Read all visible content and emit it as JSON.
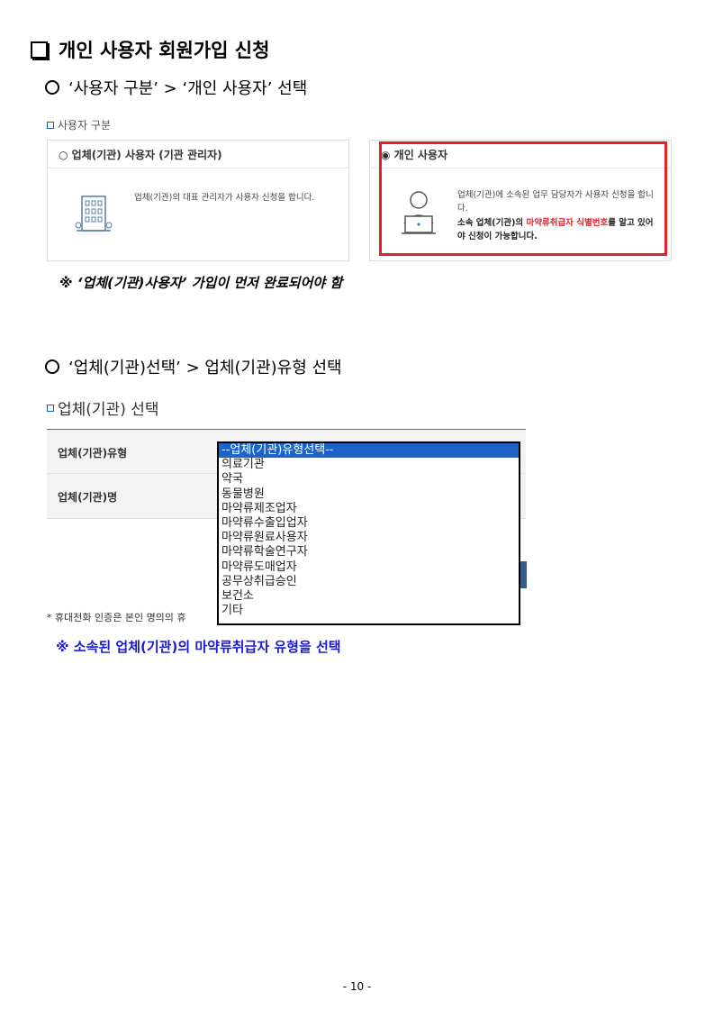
{
  "heading": "개인 사용자 회원가입 신청",
  "step1": {
    "title": "‘사용자 구분’ > ‘개인 사용자’ 선택",
    "section_label": "사용자 구분",
    "card_institution": {
      "title": "○ 업체(기관) 사용자 (기관 관리자)",
      "desc": "업체(기관)의 대표 관리자가 사용자 신청을 합니다."
    },
    "card_personal": {
      "title": "◉ 개인 사용자",
      "desc": "업체(기관)에 소속된 업무 담당자가 사용자 신청을 합니다.",
      "desc2_prefix": "소속 업체(기관)의 ",
      "desc2_highlight": "마약류취급자 식별번호",
      "desc2_suffix": "를 알고 있어야 신청이 가능합니다."
    },
    "note": "※ ‘업체(기관)사용자’ 가입이 먼저 완료되어야 함"
  },
  "step2": {
    "title": "‘업체(기관)선택’ > 업체(기관)유형 선택",
    "section_label": "업체(기관) 선택",
    "row1_label": "업체(기관)유형",
    "row2_label": "업체(기관)명",
    "options": [
      "--업체(기관)유형선택--",
      "의료기관",
      "약국",
      "동물병원",
      "마약류제조업자",
      "마약류수출입업자",
      "마약류원료사용자",
      "마약류학술연구자",
      "마약류도매업자",
      "공무상취급승인",
      "보건소",
      "기타"
    ],
    "footnote": "* 휴대전화 인증은 본인 명의의 휴",
    "note": "※ 소속된 업체(기관)의 마약류취급자 유형을 선택"
  },
  "page_number": "- 10 -",
  "colors": {
    "highlight_border": "#e3202b",
    "link_blue": "#1a1ad0",
    "select_bg": "#1e64c8"
  }
}
